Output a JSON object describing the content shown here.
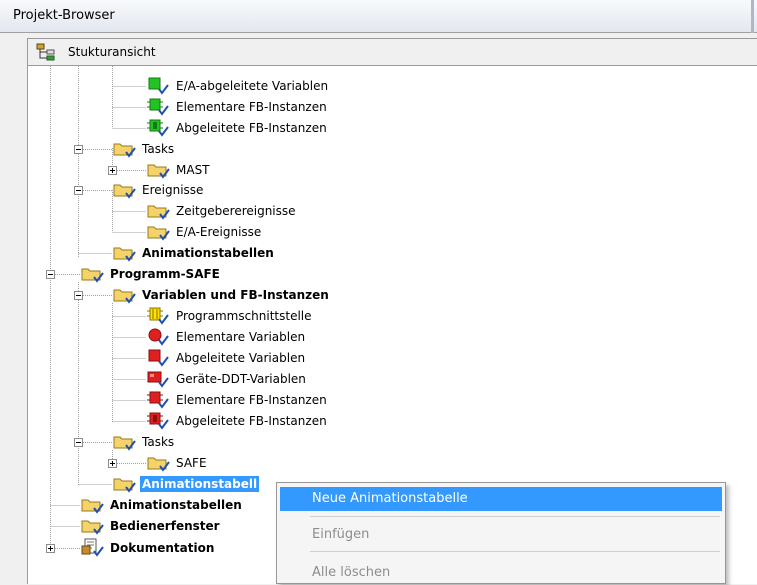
{
  "window": {
    "title": "Projekt-Browser"
  },
  "toolbar": {
    "view_label": "Stukturansicht",
    "view_icon": "structure-view-icon"
  },
  "tree": {
    "items": [
      {
        "label": "E/A-abgeleitete Variablen",
        "icon": "green-block-icon",
        "bold": false
      },
      {
        "label": "Elementare FB-Instanzen",
        "icon": "green-fb-icon",
        "bold": false
      },
      {
        "label": "Abgeleitete FB-Instanzen",
        "icon": "green-dfb-icon",
        "bold": false
      },
      {
        "label": "Tasks",
        "icon": "folder-icon",
        "bold": false
      },
      {
        "label": "MAST",
        "icon": "folder-icon",
        "bold": false
      },
      {
        "label": "Ereignisse",
        "icon": "folder-icon",
        "bold": false
      },
      {
        "label": "Zeitgeberereignisse",
        "icon": "folder-icon",
        "bold": false
      },
      {
        "label": "E/A-Ereignisse",
        "icon": "folder-icon",
        "bold": false
      },
      {
        "label": "Animationstabellen",
        "icon": "folder-icon",
        "bold": true
      },
      {
        "label": "Programm-SAFE",
        "icon": "folder-icon",
        "bold": true
      },
      {
        "label": "Variablen und FB-Instanzen",
        "icon": "folder-icon",
        "bold": true
      },
      {
        "label": "Programmschnittstelle",
        "icon": "yellow-interface-icon",
        "bold": false
      },
      {
        "label": "Elementare Variablen",
        "icon": "red-circle-icon",
        "bold": false
      },
      {
        "label": "Abgeleitete Variablen",
        "icon": "red-block-icon",
        "bold": false
      },
      {
        "label": "Geräte-DDT-Variablen",
        "icon": "red-device-icon",
        "bold": false
      },
      {
        "label": "Elementare FB-Instanzen",
        "icon": "red-fb-icon",
        "bold": false
      },
      {
        "label": "Abgeleitete FB-Instanzen",
        "icon": "red-dfb-icon",
        "bold": false
      },
      {
        "label": "Tasks",
        "icon": "folder-icon",
        "bold": false
      },
      {
        "label": "SAFE",
        "icon": "folder-icon",
        "bold": false
      },
      {
        "label": "Animationstabell",
        "icon": "folder-icon",
        "bold": true,
        "selected": true
      },
      {
        "label": "Animationstabellen",
        "icon": "folder-icon",
        "bold": true
      },
      {
        "label": "Bedienerfenster",
        "icon": "folder-icon",
        "bold": true
      },
      {
        "label": "Dokumentation",
        "icon": "documentation-icon",
        "bold": true
      }
    ]
  },
  "context_menu": {
    "items": [
      {
        "label": "Neue Animationstabelle",
        "state": "highlighted"
      },
      {
        "label": "Einfügen",
        "state": "disabled"
      },
      {
        "label": "Alle löschen",
        "state": "disabled"
      }
    ]
  },
  "colors": {
    "selection": "#3399ff",
    "folder": "#f4d36a",
    "green": "#22c322",
    "red": "#e02020",
    "yellow": "#ffe000"
  }
}
